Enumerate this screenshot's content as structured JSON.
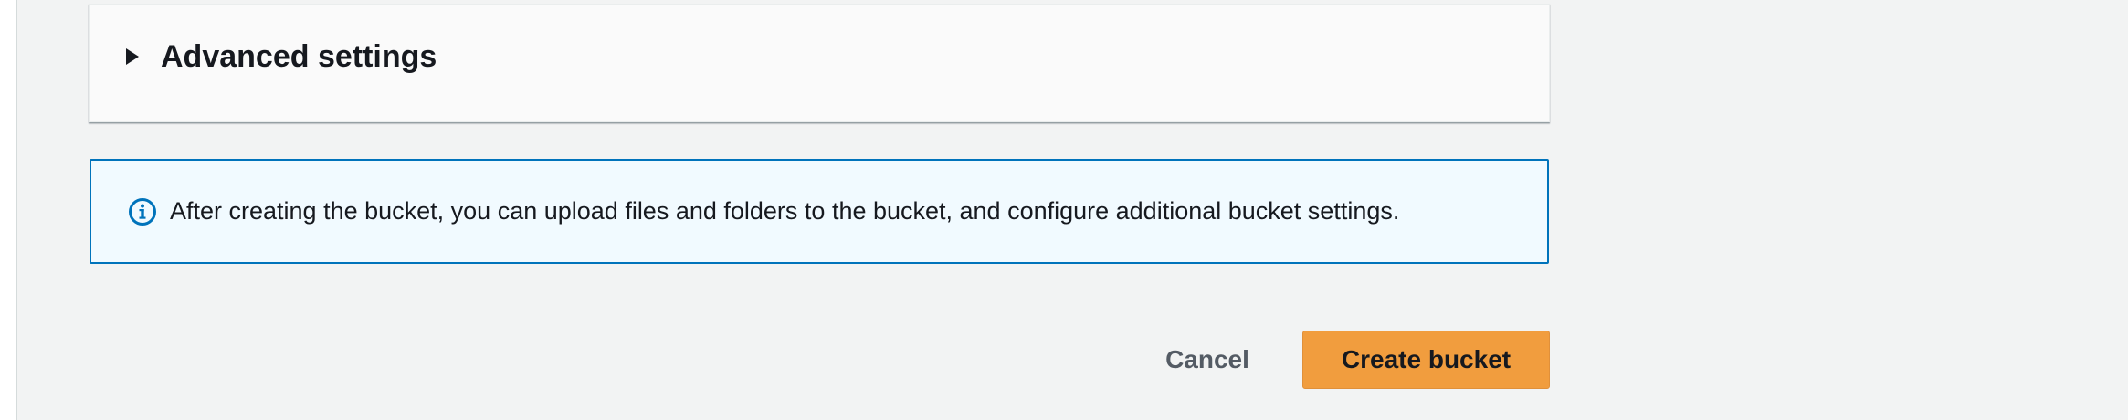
{
  "advanced_settings": {
    "title": "Advanced settings",
    "expanded": false,
    "caret_icon": "caret-right-icon"
  },
  "info_alert": {
    "icon": "info-icon",
    "text": "After creating the bucket, you can upload files and folders to the bucket, and configure additional bucket settings.",
    "color": "#0073bb"
  },
  "actions": {
    "cancel_label": "Cancel",
    "create_label": "Create bucket",
    "primary_color": "#f19d3e"
  }
}
